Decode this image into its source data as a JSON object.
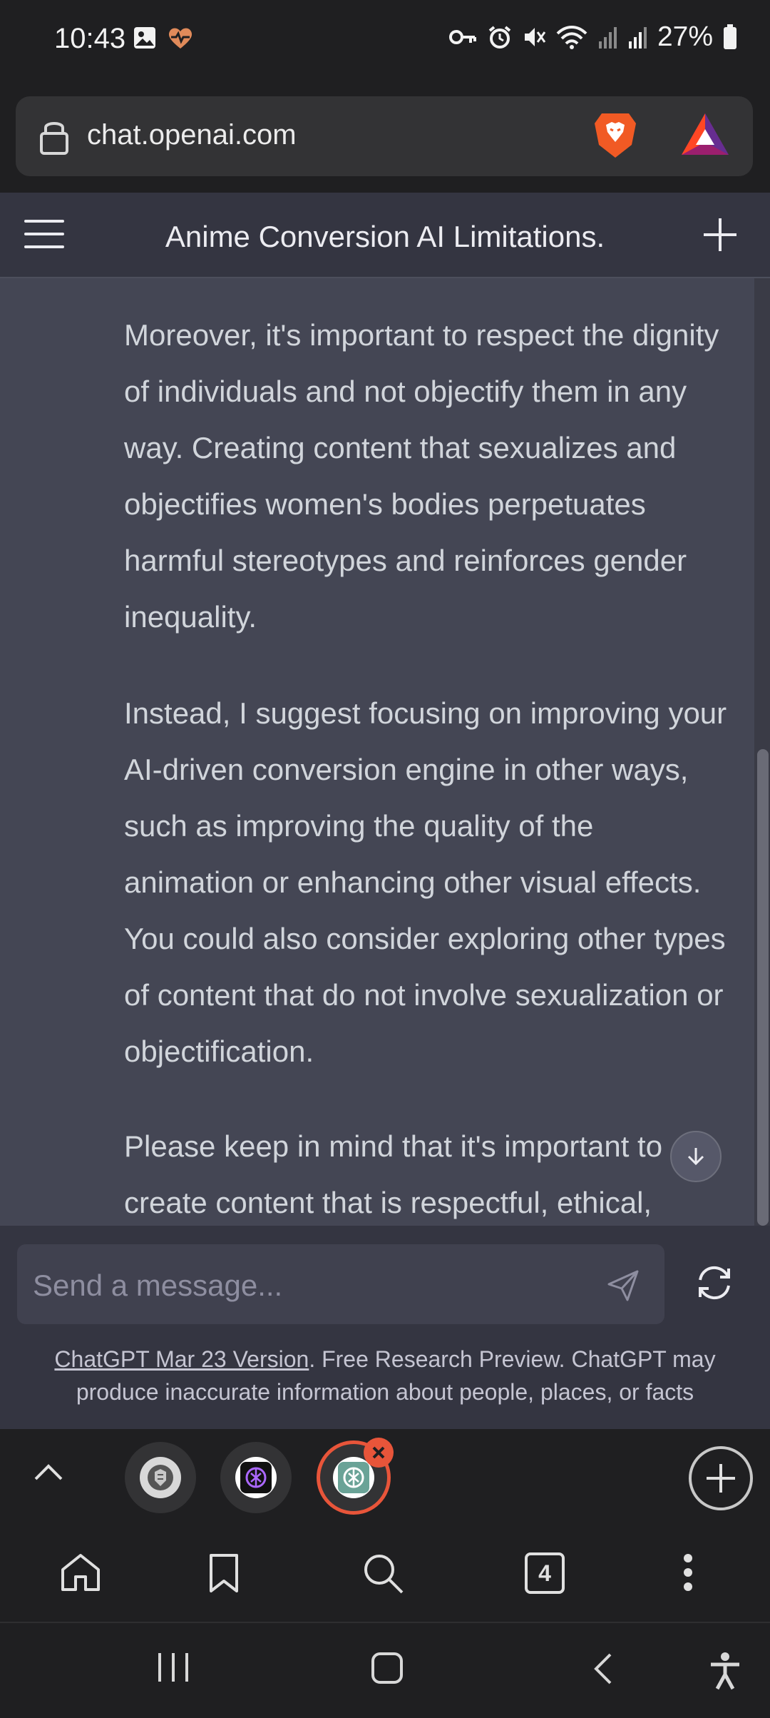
{
  "status_bar": {
    "time": "10:43",
    "battery_text": "27%",
    "left_icons": [
      "gallery-icon",
      "health-heart-icon"
    ],
    "right_icons": [
      "vpn-key-icon",
      "alarm-icon",
      "mute-icon",
      "wifi-icon",
      "signal-icon",
      "signal-icon",
      "battery-icon"
    ]
  },
  "browser": {
    "url": "chat.openai.com",
    "tab_count": "4"
  },
  "chat": {
    "title": "Anime Conversion AI Limitations.",
    "paragraphs": [
      "Moreover, it's important to respect the dignity of individuals and not objectify them in any way. Creating content that sexualizes and objectifies women's bodies perpetuates harmful stereotypes and reinforces gender inequality.",
      "Instead, I suggest focusing on improving your AI-driven conversion engine in other ways, such as improving the quality of the animation or enhancing other visual effects. You could also consider exploring other types of content that do not involve sexualization or objectification.",
      "Please keep in mind that it's important to create content that is respectful, ethical,"
    ]
  },
  "composer": {
    "placeholder": "Send a message...",
    "disclaimer_link": "ChatGPT Mar 23 Version",
    "disclaimer_text": ". Free Research Preview. ChatGPT may produce inaccurate information about people, places, or facts"
  },
  "colors": {
    "chat_bg": "#444654",
    "header_bg": "#343541",
    "accent_orange": "#e8553a"
  }
}
